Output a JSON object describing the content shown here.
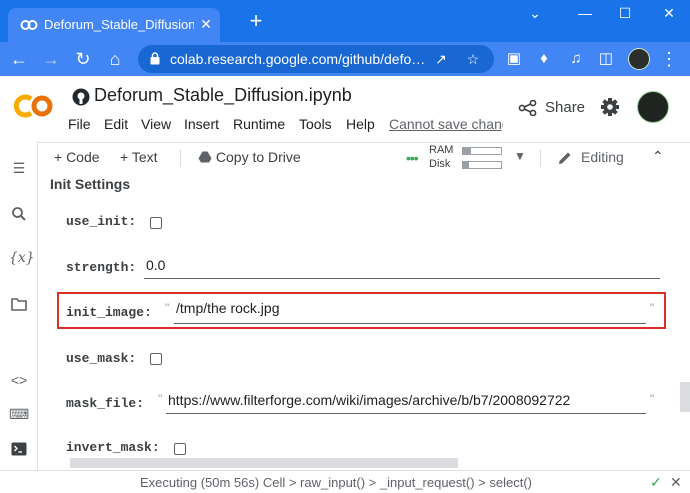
{
  "browser": {
    "tab_title": "Deforum_Stable_Diffusion.ip",
    "tab_close": "✕",
    "new_tab": "+",
    "window_controls": {
      "collapse": "⌄",
      "minimize": "—",
      "maximize": "☐",
      "close": "✕"
    },
    "url": "colab.research.google.com/github/defo…",
    "accent_color": "#1a73e8"
  },
  "colab": {
    "notebook_title": "Deforum_Stable_Diffusion.ipynb",
    "menu": [
      "File",
      "Edit",
      "View",
      "Insert",
      "Runtime",
      "Tools",
      "Help"
    ],
    "cannot_save": "Cannot save chang",
    "share_label": "Share"
  },
  "toolbar": {
    "add_code": "+ Code",
    "add_text": "+ Text",
    "copy_to_drive": "Copy to Drive",
    "ram_label": "RAM",
    "disk_label": "Disk",
    "ram_fraction": 0.2,
    "disk_fraction": 0.15,
    "editing_label": "Editing"
  },
  "section": {
    "title": "Init Settings"
  },
  "params": {
    "use_init": {
      "label": "use_init:",
      "checked": false
    },
    "strength": {
      "label": "strength:",
      "value": "0.0"
    },
    "init_image": {
      "label": "init_image:",
      "value": "/tmp/the rock.jpg"
    },
    "use_mask": {
      "label": "use_mask:",
      "checked": false
    },
    "mask_file": {
      "label": "mask_file:",
      "value": "https://www.filterforge.com/wiki/images/archive/b/b7/2008092722"
    },
    "invert_mask": {
      "label": "invert_mask:",
      "checked": false
    }
  },
  "status": {
    "text": "Executing (50m 56s)  Cell > raw_input() > _input_request() > select()",
    "check": "✓",
    "close": "✕"
  }
}
